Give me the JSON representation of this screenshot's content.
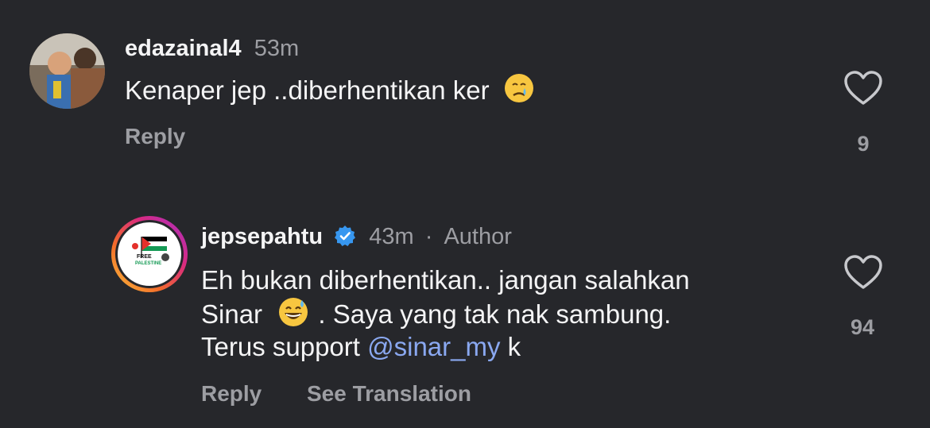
{
  "comments": [
    {
      "username": "edazainal4",
      "time": "53m",
      "text": "Kenaper jep ..diberhentikan ker",
      "emoji": "crying-face-emoji",
      "reply_label": "Reply",
      "like_count": "9"
    },
    {
      "username": "jepsepahtu",
      "time": "43m",
      "separator": "·",
      "author_label": "Author",
      "text_line1": "Eh bukan diberhentikan.. jangan salahkan",
      "text_line2_a": "Sinar",
      "text_line2_b": ". Saya yang tak nak sambung.",
      "text_line3_a": "Terus support ",
      "mention": "@sinar_my",
      "text_line3_b": " k",
      "emoji": "grinning-sweat-emoji",
      "reply_label": "Reply",
      "translate_label": "See Translation",
      "like_count": "94",
      "avatar_text_1": "FREE",
      "avatar_text_2": "PALESTINE"
    }
  ],
  "colors": {
    "background": "#26272b",
    "text": "#f4f4f5",
    "muted": "#9d9ea3",
    "mention": "#8aa8f0",
    "verified": "#3797f0"
  }
}
